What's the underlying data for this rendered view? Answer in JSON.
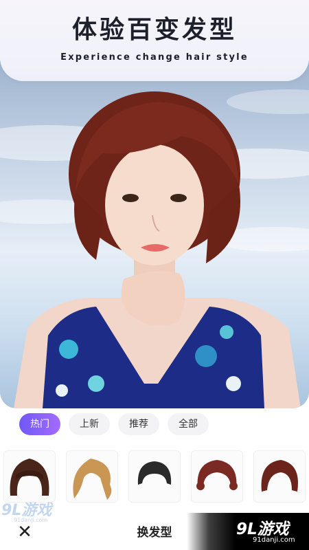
{
  "header": {
    "title": "体验百变发型",
    "subtitle": "Experience change hair style"
  },
  "tabs": [
    {
      "label": "热门",
      "active": true
    },
    {
      "label": "上新",
      "active": false
    },
    {
      "label": "推荐",
      "active": false
    },
    {
      "label": "全部",
      "active": false
    }
  ],
  "hairstyles": [
    {
      "icon": "bob-bangs-dark-brown-hair-icon",
      "color": "#4a2519"
    },
    {
      "icon": "wavy-blonde-hair-icon",
      "color": "#c99654"
    },
    {
      "icon": "short-black-hair-icon",
      "color": "#2a2a2a"
    },
    {
      "icon": "curly-auburn-hair-icon",
      "color": "#7a2a22"
    },
    {
      "icon": "short-auburn-hair-icon",
      "color": "#6b241c"
    }
  ],
  "bottom_bar": {
    "close_icon": "close-icon",
    "action_label": "换发型"
  },
  "watermark": {
    "logo": "9L游戏",
    "url": "91danji.com"
  },
  "colors": {
    "active_tab_gradient_start": "#6f58f5",
    "active_tab_gradient_end": "#a46bff",
    "title_color": "#1d1f2b"
  }
}
